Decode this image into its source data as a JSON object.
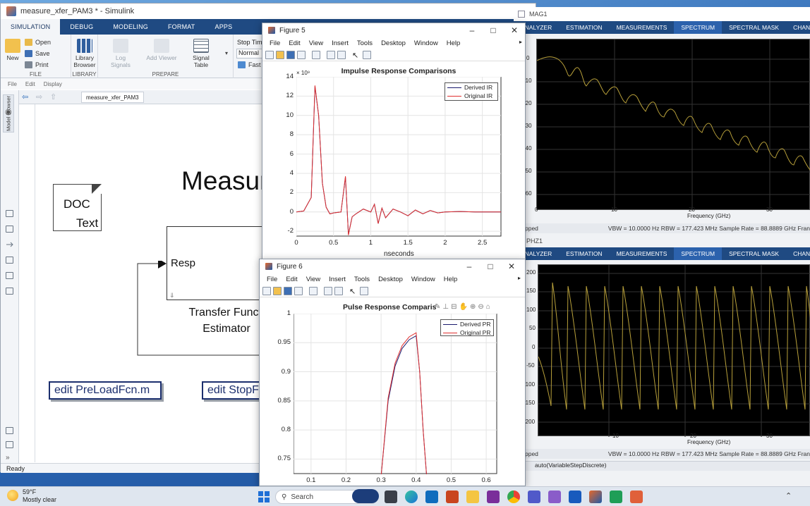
{
  "simulink": {
    "title": "measure_xfer_PAM3 * - Simulink",
    "tabs": [
      "SIMULATION",
      "DEBUG",
      "MODELING",
      "FORMAT",
      "APPS"
    ],
    "file_group": {
      "new": "New",
      "open": "Open",
      "save": "Save",
      "print": "Print",
      "label": "FILE"
    },
    "library": {
      "button": "Library Browser",
      "label": "LIBRARY"
    },
    "prepare": {
      "log_signals": "Log Signals",
      "add_viewer": "Add Viewer",
      "signal_table": "Signal Table",
      "label": "PREPARE"
    },
    "stop_time_label": "Stop Time",
    "mode_value": "Normal",
    "fast_restart": "Fast R",
    "menu": [
      "File",
      "Edit",
      "Display"
    ],
    "breadcrumb": "measure_xfer_PAM3",
    "model_browser": "Model Browser",
    "status": "Ready",
    "solver": "auto(VariableStepDiscrete)",
    "canvas": {
      "doc_line1": "DOC",
      "doc_line2": "Text",
      "measure_title": "Measure",
      "resp_label": "Resp",
      "tf_caption_line1": "Transfer Functi",
      "tf_caption_line2": "Estimator",
      "preload_button": "edit PreLoadFcn.m",
      "stop_button": "edit StopF"
    }
  },
  "figure5": {
    "title": "Figure 5",
    "menu": [
      "File",
      "Edit",
      "View",
      "Insert",
      "Tools",
      "Desktop",
      "Window",
      "Help"
    ],
    "chart_title": "Impulse Response Comparisons",
    "xlabel": "nseconds",
    "yscale_label": "× 10⁹",
    "xticks": [
      "0",
      "0.5",
      "1",
      "1.5",
      "2",
      "2.5"
    ],
    "yticks": [
      "14",
      "12",
      "10",
      "8",
      "6",
      "4",
      "2",
      "0",
      "-2"
    ],
    "legend": [
      "Derived IR",
      "Original IR"
    ]
  },
  "figure6": {
    "title": "Figure 6",
    "menu": [
      "File",
      "Edit",
      "View",
      "Insert",
      "Tools",
      "Desktop",
      "Window",
      "Help"
    ],
    "chart_title": "Pulse Response Comparis",
    "xticks": [
      "0.1",
      "0.2",
      "0.3",
      "0.4",
      "0.5",
      "0.6"
    ],
    "yticks": [
      "1",
      "0.95",
      "0.9",
      "0.85",
      "0.8",
      "0.75"
    ],
    "legend": [
      "Derived PR",
      "Original PR"
    ]
  },
  "spectrum": {
    "title1": "MAG1",
    "title2": "PHZ1",
    "tabs": [
      "ANALYZER",
      "ESTIMATION",
      "MEASUREMENTS",
      "SPECTRUM",
      "SPECTRAL MASK",
      "CHANNEL MEASU"
    ],
    "mag_yticks": [
      "0",
      "-10",
      "-20",
      "-30",
      "-40",
      "-50",
      "-60"
    ],
    "phz_yticks": [
      "200",
      "150",
      "100",
      "50",
      "0",
      "-50",
      "-100",
      "-150",
      "-200"
    ],
    "xticks": [
      "0",
      "10",
      "20",
      "30"
    ],
    "xlabel": "Frequency (GHz)",
    "stopped": "pped",
    "status_line": "VBW = 10.0000 Hz  RBW = 177.423 MHz  Sample Rate = 88.8889 GHz  Fran"
  },
  "taskbar": {
    "weather_temp": "59°F",
    "weather_desc": "Mostly clear",
    "search_placeholder": "Search"
  },
  "chart_data": [
    {
      "type": "line",
      "title": "Impulse Response Comparisons",
      "xlabel": "nseconds",
      "ylabel": "",
      "xlim": [
        0,
        2.75
      ],
      "ylim": [
        -2.5,
        14
      ],
      "series": [
        {
          "name": "Derived IR",
          "color": "#1a1a6e",
          "x": [
            0,
            0.1,
            0.2,
            0.25,
            0.3,
            0.35,
            0.4,
            0.45,
            0.5,
            0.6,
            0.66,
            0.7,
            0.75,
            0.8,
            0.9,
            1.0,
            1.05,
            1.1,
            1.15,
            1.2,
            1.3,
            1.4,
            1.5,
            1.6,
            1.7,
            1.8,
            1.9,
            2.0,
            2.2,
            2.4,
            2.6,
            2.75
          ],
          "y": [
            0,
            0.1,
            1.5,
            13,
            10,
            3,
            0.5,
            -0.2,
            -0.1,
            0,
            3.6,
            -2.3,
            -0.5,
            -0.2,
            0.3,
            0,
            0.8,
            -1.2,
            0.4,
            -0.6,
            0.3,
            0,
            -0.4,
            0.2,
            -0.2,
            0.15,
            -0.1,
            0,
            0.05,
            0,
            0,
            0
          ]
        },
        {
          "name": "Original IR",
          "color": "#e03030",
          "x": [
            0,
            0.1,
            0.2,
            0.25,
            0.3,
            0.35,
            0.4,
            0.45,
            0.5,
            0.6,
            0.66,
            0.7,
            0.75,
            0.8,
            0.9,
            1.0,
            1.05,
            1.1,
            1.15,
            1.2,
            1.3,
            1.4,
            1.5,
            1.6,
            1.7,
            1.8,
            1.9,
            2.0,
            2.2,
            2.4,
            2.6,
            2.75
          ],
          "y": [
            0,
            0.1,
            1.5,
            13.1,
            10,
            3,
            0.5,
            -0.2,
            -0.1,
            0,
            3.7,
            -2.4,
            -0.5,
            -0.2,
            0.3,
            0,
            0.8,
            -1.2,
            0.4,
            -0.6,
            0.3,
            0,
            -0.4,
            0.2,
            -0.2,
            0.15,
            -0.1,
            0,
            0.05,
            0,
            0,
            0
          ]
        }
      ]
    },
    {
      "type": "line",
      "title": "Pulse Response Comparis",
      "xlabel": "",
      "ylabel": "",
      "xlim": [
        0.05,
        0.63
      ],
      "ylim": [
        0.725,
        1.0
      ],
      "series": [
        {
          "name": "Derived PR",
          "color": "#1a1a6e",
          "x": [
            0.3,
            0.32,
            0.34,
            0.36,
            0.38,
            0.4,
            0.41,
            0.42,
            0.43
          ],
          "y": [
            0.72,
            0.85,
            0.91,
            0.94,
            0.955,
            0.962,
            0.9,
            0.8,
            0.72
          ]
        },
        {
          "name": "Original PR",
          "color": "#e03030",
          "x": [
            0.3,
            0.32,
            0.34,
            0.36,
            0.38,
            0.4,
            0.41,
            0.42,
            0.43
          ],
          "y": [
            0.72,
            0.855,
            0.915,
            0.945,
            0.96,
            0.967,
            0.9,
            0.8,
            0.72
          ]
        }
      ]
    }
  ]
}
